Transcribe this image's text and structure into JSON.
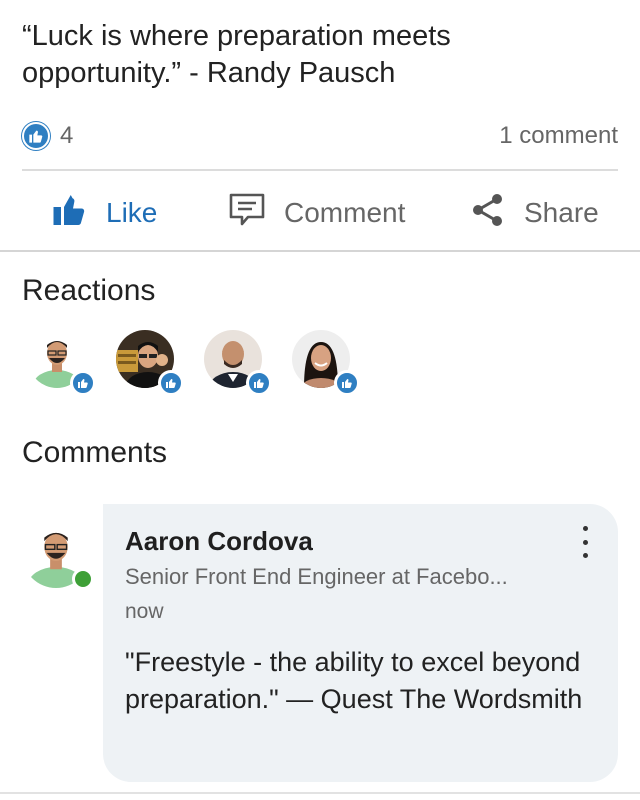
{
  "post": {
    "text": "“Luck is where preparation meets opportunity.” - Randy Pausch",
    "like_count": "4",
    "comment_count": "1 comment"
  },
  "actions": {
    "like": "Like",
    "comment": "Comment",
    "share": "Share"
  },
  "reactions": {
    "title": "Reactions",
    "count_shown": 4,
    "reaction_icon": "thumbs-up-icon"
  },
  "comments": {
    "title": "Comments",
    "items": [
      {
        "author": "Aaron Cordova",
        "headline": "Senior Front End Engineer at Facebo...",
        "time": "now",
        "text": "\"Freestyle - the ability to excel beyond preparation.\" — Quest The Wordsmith",
        "online": true
      }
    ]
  },
  "colors": {
    "accent": "#1e6db6",
    "like_badge": "#2f7fc2",
    "online": "#3ea037",
    "bubble": "#eef2f5"
  }
}
